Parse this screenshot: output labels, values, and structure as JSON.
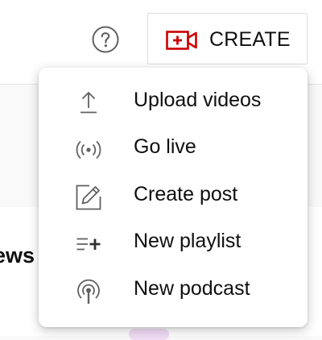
{
  "header": {
    "help_icon": "help-circle-icon",
    "create": {
      "label": "CREATE",
      "icon": "video-camera-add-icon",
      "accent_color": "#cc0000"
    }
  },
  "background": {
    "partial_text": "ews"
  },
  "create_menu": {
    "items": [
      {
        "label": "Upload videos",
        "icon": "upload-icon"
      },
      {
        "label": "Go live",
        "icon": "broadcast-icon"
      },
      {
        "label": "Create post",
        "icon": "edit-post-icon"
      },
      {
        "label": "New playlist",
        "icon": "playlist-add-icon"
      },
      {
        "label": "New podcast",
        "icon": "podcast-icon"
      }
    ]
  }
}
